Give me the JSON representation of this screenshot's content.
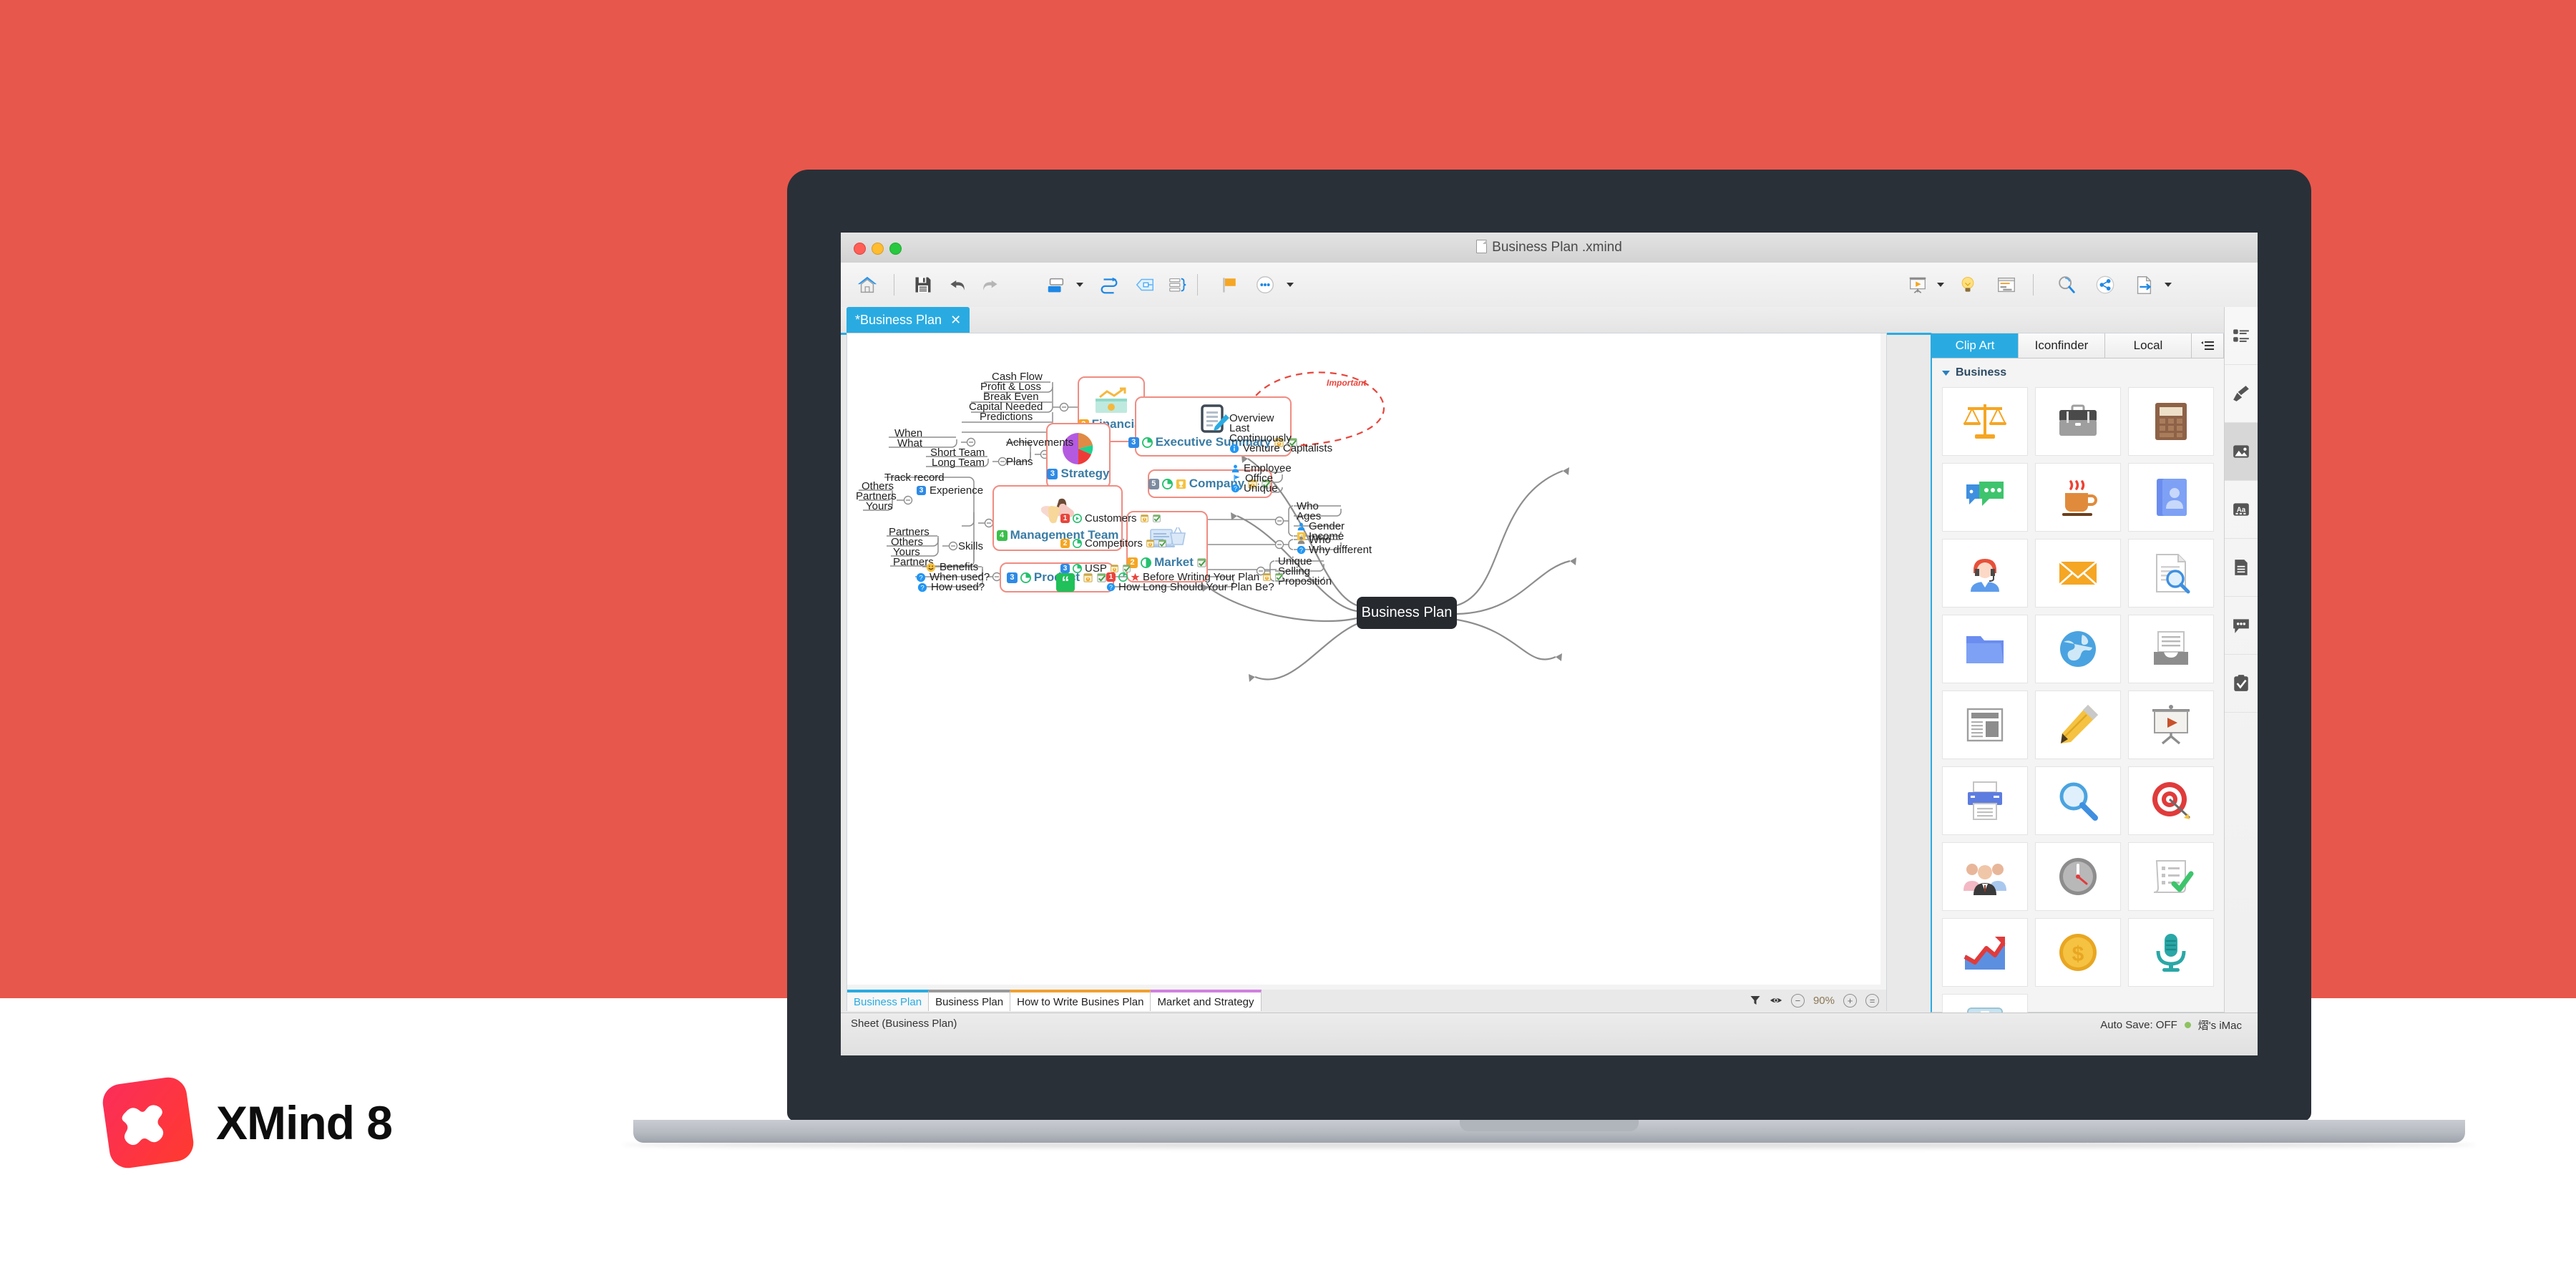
{
  "window": {
    "title": "Business Plan .xmind",
    "doc_tab_label": "*Business Plan",
    "doc_tab_close": "✕"
  },
  "toolbar": {
    "items": [
      {
        "name": "home-icon",
        "label": "Home"
      },
      {
        "name": "save-icon",
        "label": "Save"
      },
      {
        "name": "undo-icon",
        "label": "Undo"
      },
      {
        "name": "redo-icon",
        "label": "Redo"
      },
      {
        "name": "topic-icon",
        "label": "Topic"
      },
      {
        "name": "relationship-icon",
        "label": "Relationship"
      },
      {
        "name": "boundary-icon",
        "label": "Boundary"
      },
      {
        "name": "summary-icon",
        "label": "Summary"
      },
      {
        "name": "marker-icon",
        "label": "Marker"
      },
      {
        "name": "more-icon",
        "label": "More"
      }
    ],
    "right_items": [
      {
        "name": "presentation-icon",
        "label": "Presentation"
      },
      {
        "name": "brainstorm-icon",
        "label": "Brainstorming"
      },
      {
        "name": "outline-icon",
        "label": "Outline"
      },
      {
        "name": "search-icon",
        "label": "Search"
      },
      {
        "name": "share-icon",
        "label": "Share"
      },
      {
        "name": "export-icon",
        "label": "Export"
      }
    ]
  },
  "map": {
    "root": "Business Plan",
    "relationship_label": "Important",
    "branches": {
      "financial": {
        "number": "2",
        "title": "Financial",
        "children": [
          "Cash Flow",
          "Profit & Loss",
          "Break Even",
          "Capital Needed",
          "Predictions"
        ]
      },
      "strategy": {
        "number": "3",
        "title": "Strategy",
        "sub": [
          {
            "label": "Achievements",
            "children": [
              "When",
              "What"
            ]
          },
          {
            "label": "Plans",
            "children": [
              "Short Team",
              "Long Team"
            ]
          }
        ]
      },
      "management_team": {
        "number": "4",
        "title": "Management Team",
        "sub": [
          {
            "label": "Experience",
            "number": "3",
            "children": [
              "Others",
              "Partners",
              "Yours"
            ],
            "extra": "Track record"
          },
          {
            "label": "Skills",
            "children": [
              "Others",
              "Yours"
            ],
            "top": "Partners",
            "bottom": "Partners"
          }
        ]
      },
      "product": {
        "number": "3",
        "title": "Product",
        "children": [
          "Benefits",
          "When used?",
          "How used?"
        ]
      },
      "executive_summary": {
        "number": "3",
        "title": "Executive Summary",
        "children": [
          "Overview",
          "Last",
          "Continuously",
          "Venture Capitalists"
        ]
      },
      "company": {
        "number": "5",
        "title": "Company",
        "children": [
          "Employee",
          "Office",
          "Unique"
        ]
      },
      "market": {
        "number": "2",
        "title": "Market",
        "sub": [
          {
            "number": "1",
            "label": "Customers",
            "children": [
              "Who",
              "Ages",
              "Gender",
              "Income"
            ]
          },
          {
            "number": "2",
            "label": "Competitors",
            "children": [
              "Who",
              "Why different"
            ]
          },
          {
            "number": "3",
            "label": "USP",
            "children": [
              "Unique",
              "Selling",
              "Proposition"
            ]
          }
        ]
      },
      "floating": {
        "items": [
          {
            "number": "1",
            "label": "Before Writing Your Plan"
          },
          {
            "label": "How Long Should Your Plan Be?"
          }
        ]
      }
    }
  },
  "sheets": {
    "tabs": [
      {
        "label": "Business Plan",
        "active": true,
        "color": "#29abe2"
      },
      {
        "label": "Business Plan",
        "active": false,
        "color": "#9a9a9a"
      },
      {
        "label": "How to Write Busines Plan",
        "active": false,
        "color": "#f0a030"
      },
      {
        "label": "Market and Strategy",
        "active": false,
        "color": "#d07fe0"
      }
    ],
    "zoom": "90%",
    "filter_icon": "filter-icon",
    "eye_icon": "eye-icon",
    "minus_label": "−",
    "plus_label": "+",
    "fit_label": "="
  },
  "status": {
    "left": "Sheet (Business Plan)",
    "autosave": "Auto Save: OFF",
    "device": "熠's iMac"
  },
  "panel": {
    "tabs": [
      {
        "label": "Clip Art",
        "active": true
      },
      {
        "label": "Iconfinder",
        "active": false
      },
      {
        "label": "Local",
        "active": false
      }
    ],
    "menu_icon": "list-menu-icon",
    "section": "Business",
    "clipart": [
      {
        "name": "scales-icon"
      },
      {
        "name": "briefcase-icon"
      },
      {
        "name": "calculator-icon"
      },
      {
        "name": "chat-bubbles-icon"
      },
      {
        "name": "coffee-cup-icon"
      },
      {
        "name": "contact-book-icon"
      },
      {
        "name": "support-agent-icon"
      },
      {
        "name": "envelope-icon"
      },
      {
        "name": "document-search-icon"
      },
      {
        "name": "folder-icon"
      },
      {
        "name": "globe-icon"
      },
      {
        "name": "inbox-tray-icon"
      },
      {
        "name": "newspaper-icon"
      },
      {
        "name": "pencil-icon"
      },
      {
        "name": "presentation-screen-icon"
      },
      {
        "name": "printer-icon"
      },
      {
        "name": "magnifier-icon"
      },
      {
        "name": "target-icon"
      },
      {
        "name": "team-group-icon"
      },
      {
        "name": "clock-icon"
      },
      {
        "name": "checklist-icon"
      },
      {
        "name": "growth-chart-icon"
      },
      {
        "name": "dollar-coin-icon"
      },
      {
        "name": "microphone-icon"
      },
      {
        "name": "tablet-news-icon"
      }
    ]
  },
  "sidebar_strip": [
    {
      "name": "properties-icon"
    },
    {
      "name": "brush-icon"
    },
    {
      "name": "image-icon",
      "active": true
    },
    {
      "name": "text-aa-icon"
    },
    {
      "name": "notes-icon"
    },
    {
      "name": "comments-icon"
    },
    {
      "name": "task-clipboard-icon"
    }
  ],
  "brand": {
    "name": "XMind 8"
  },
  "colors": {
    "background": "#e8574b",
    "accent": "#29abe2",
    "node_border": "#f08c82",
    "root_bg": "#26292e",
    "brand_red": "#fb2d5a"
  }
}
